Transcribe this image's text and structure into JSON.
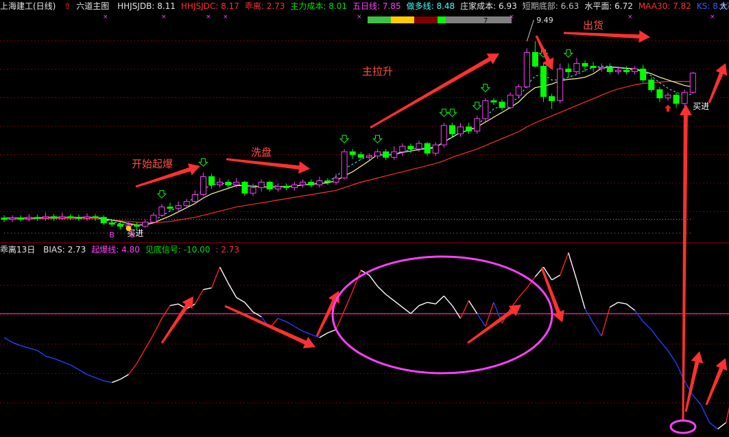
{
  "header": {
    "stock_name": "上海建工(日线)",
    "indicator_name": "六道主图",
    "items": [
      {
        "label": "HHJSJDB:",
        "value": "8.11",
        "color": "#e6e6e6"
      },
      {
        "label": "HHJSJDC:",
        "value": "8.17",
        "color": "#ff3030"
      },
      {
        "label": "乖离:",
        "value": "2.73",
        "color": "#ff3030"
      },
      {
        "label": "主力成本:",
        "value": "8.01",
        "color": "#00e000"
      },
      {
        "label": "五日线:",
        "value": "7.85",
        "color": "#ff40ff"
      },
      {
        "label": "做多线:",
        "value": "8.48",
        "color": "#40ffff"
      },
      {
        "label": "庄家成本:",
        "value": "6.93",
        "color": "#e6e6e6"
      },
      {
        "label": "短期底部:",
        "value": "6.63",
        "color": "#bbbbbb"
      },
      {
        "label": "水平面:",
        "value": "6.72",
        "color": "#e6e6e6"
      },
      {
        "label": "MAA30:",
        "value": "7.82",
        "color": "#ff3030"
      },
      {
        "label": "KS:",
        "value": "8.07",
        "color": "#3060ff"
      }
    ],
    "corner": "大"
  },
  "panel2": {
    "name": "乖离13日",
    "items": [
      {
        "label": "BIAS:",
        "value": "2.73",
        "color": "#e6e6e6"
      },
      {
        "label": "起爆线:",
        "value": "4.80",
        "color": "#ff40ff"
      },
      {
        "label": "见底信号:",
        "value": "-10.00",
        "color": "#00e000"
      },
      {
        "label": ":",
        "value": "2.73",
        "color": "#ff3030"
      }
    ]
  },
  "strength_bar": {
    "segments": [
      {
        "color": "#40c040"
      },
      {
        "color": "#ffcc00"
      },
      {
        "color": "#800000"
      },
      {
        "color": "#00ff00"
      },
      {
        "color": "#808080"
      }
    ],
    "marker": "7"
  },
  "annotations": {
    "start": "开始起爆",
    "wash": "洗盘",
    "main_up": "主拉升",
    "sell": "出货",
    "buy1": "买进",
    "buy2": "买进",
    "b1": "B",
    "b2": "B",
    "peak": "9.49"
  },
  "chart_data": [
    {
      "type": "candlestick",
      "title": "上海建工(日线)",
      "peak_label": 9.49,
      "ylim": [
        6.3,
        9.6
      ],
      "candles": [
        [
          6.62,
          6.6,
          6.66,
          6.56
        ],
        [
          6.6,
          6.62,
          6.66,
          6.56
        ],
        [
          6.62,
          6.61,
          6.66,
          6.57
        ],
        [
          6.61,
          6.63,
          6.68,
          6.57
        ],
        [
          6.63,
          6.62,
          6.67,
          6.58
        ],
        [
          6.62,
          6.64,
          6.7,
          6.58
        ],
        [
          6.64,
          6.62,
          6.68,
          6.58
        ],
        [
          6.62,
          6.64,
          6.7,
          6.59
        ],
        [
          6.64,
          6.63,
          6.68,
          6.59
        ],
        [
          6.63,
          6.62,
          6.67,
          6.58
        ],
        [
          6.62,
          6.64,
          6.69,
          6.58
        ],
        [
          6.64,
          6.63,
          6.68,
          6.58
        ],
        [
          6.63,
          6.55,
          6.66,
          6.52
        ],
        [
          6.55,
          6.53,
          6.6,
          6.5
        ],
        [
          6.53,
          6.5,
          6.56,
          6.45
        ],
        [
          6.5,
          6.52,
          6.56,
          6.46
        ],
        [
          6.52,
          6.5,
          6.56,
          6.46
        ],
        [
          6.5,
          6.56,
          6.6,
          6.48
        ],
        [
          6.56,
          6.66,
          6.7,
          6.54
        ],
        [
          6.66,
          6.78,
          6.82,
          6.64
        ],
        [
          6.78,
          6.76,
          6.84,
          6.72
        ],
        [
          6.76,
          6.8,
          6.86,
          6.72
        ],
        [
          6.8,
          6.86,
          6.9,
          6.76
        ],
        [
          6.86,
          6.96,
          7.02,
          6.82
        ],
        [
          6.96,
          7.22,
          7.28,
          6.94
        ],
        [
          7.22,
          7.1,
          7.26,
          7.04
        ],
        [
          7.1,
          7.14,
          7.2,
          7.06
        ],
        [
          7.14,
          7.1,
          7.18,
          7.04
        ],
        [
          7.1,
          7.14,
          7.2,
          7.06
        ],
        [
          7.14,
          6.98,
          7.16,
          6.94
        ],
        [
          6.98,
          7.06,
          7.12,
          6.94
        ],
        [
          7.06,
          7.14,
          7.18,
          7.0
        ],
        [
          7.14,
          7.04,
          7.16,
          7.0
        ],
        [
          7.04,
          7.08,
          7.12,
          7.0
        ],
        [
          7.08,
          7.06,
          7.12,
          7.02
        ],
        [
          7.06,
          7.1,
          7.14,
          7.02
        ],
        [
          7.1,
          7.14,
          7.18,
          7.06
        ],
        [
          7.14,
          7.1,
          7.18,
          7.06
        ],
        [
          7.1,
          7.16,
          7.22,
          7.06
        ],
        [
          7.16,
          7.14,
          7.2,
          7.1
        ],
        [
          7.14,
          7.2,
          7.26,
          7.1
        ],
        [
          7.2,
          7.58,
          7.62,
          7.18
        ],
        [
          7.58,
          7.54,
          7.62,
          7.48
        ],
        [
          7.54,
          7.5,
          7.58,
          7.46
        ],
        [
          7.5,
          7.52,
          7.56,
          7.46
        ],
        [
          7.52,
          7.58,
          7.62,
          7.48
        ],
        [
          7.58,
          7.5,
          7.62,
          7.46
        ],
        [
          7.5,
          7.58,
          7.66,
          7.46
        ],
        [
          7.58,
          7.66,
          7.7,
          7.52
        ],
        [
          7.66,
          7.62,
          7.7,
          7.56
        ],
        [
          7.62,
          7.7,
          7.74,
          7.58
        ],
        [
          7.7,
          7.56,
          7.72,
          7.52
        ],
        [
          7.56,
          7.68,
          7.72,
          7.52
        ],
        [
          7.68,
          7.96,
          8.0,
          7.64
        ],
        [
          7.96,
          7.84,
          8.0,
          7.78
        ],
        [
          7.84,
          7.94,
          8.0,
          7.8
        ],
        [
          7.94,
          7.88,
          8.0,
          7.84
        ],
        [
          7.88,
          8.06,
          8.1,
          7.84
        ],
        [
          8.06,
          8.32,
          8.36,
          8.02
        ],
        [
          8.32,
          8.3,
          8.36,
          8.26
        ],
        [
          8.3,
          8.22,
          8.34,
          8.18
        ],
        [
          8.22,
          8.4,
          8.44,
          8.2
        ],
        [
          8.4,
          8.52,
          8.56,
          8.36
        ],
        [
          8.52,
          9.02,
          9.08,
          8.5
        ],
        [
          9.02,
          8.82,
          9.18,
          8.8
        ],
        [
          8.82,
          8.38,
          8.86,
          8.3
        ],
        [
          8.38,
          8.32,
          8.42,
          8.2
        ],
        [
          8.32,
          8.78,
          8.86,
          8.28
        ],
        [
          8.78,
          8.74,
          8.86,
          8.66
        ],
        [
          8.74,
          8.86,
          8.94,
          8.7
        ],
        [
          8.86,
          8.82,
          8.9,
          8.74
        ],
        [
          8.82,
          8.8,
          8.88,
          8.74
        ],
        [
          8.8,
          8.8,
          8.86,
          8.74
        ],
        [
          8.8,
          8.74,
          8.86,
          8.7
        ],
        [
          8.74,
          8.76,
          8.82,
          8.7
        ],
        [
          8.76,
          8.74,
          8.82,
          8.7
        ],
        [
          8.74,
          8.78,
          8.82,
          8.7
        ],
        [
          8.78,
          8.62,
          8.84,
          8.58
        ],
        [
          8.62,
          8.48,
          8.66,
          8.44
        ],
        [
          8.48,
          8.36,
          8.52,
          8.3
        ],
        [
          8.36,
          8.4,
          8.44,
          8.32
        ],
        [
          8.4,
          8.28,
          8.44,
          8.22
        ],
        [
          8.28,
          8.44,
          8.48,
          8.24
        ],
        [
          8.44,
          8.72,
          8.74,
          8.42
        ]
      ],
      "ma_fast": [
        6.62,
        6.62,
        6.62,
        6.62,
        6.62,
        6.63,
        6.63,
        6.63,
        6.63,
        6.63,
        6.63,
        6.63,
        6.61,
        6.59,
        6.57,
        6.54,
        6.52,
        6.52,
        6.55,
        6.6,
        6.65,
        6.71,
        6.77,
        6.83,
        6.91,
        6.97,
        7.01,
        7.05,
        7.09,
        7.09,
        7.08,
        7.07,
        7.07,
        7.07,
        7.08,
        7.08,
        7.1,
        7.11,
        7.12,
        7.13,
        7.16,
        7.23,
        7.29,
        7.37,
        7.45,
        7.54,
        7.53,
        7.54,
        7.57,
        7.59,
        7.61,
        7.63,
        7.65,
        7.72,
        7.79,
        7.86,
        7.89,
        7.94,
        8.01,
        8.08,
        8.15,
        8.22,
        8.3,
        8.42,
        8.51,
        8.53,
        8.56,
        8.61,
        8.63,
        8.64,
        8.66,
        8.71,
        8.79,
        8.81,
        8.8,
        8.79,
        8.78,
        8.75,
        8.71,
        8.66,
        8.62,
        8.58,
        8.54,
        8.52
      ],
      "ma_slow": [
        6.6,
        6.6,
        6.6,
        6.6,
        6.61,
        6.61,
        6.61,
        6.61,
        6.61,
        6.61,
        6.61,
        6.61,
        6.6,
        6.59,
        6.58,
        6.57,
        6.56,
        6.55,
        6.55,
        6.56,
        6.57,
        6.59,
        6.61,
        6.63,
        6.66,
        6.69,
        6.72,
        6.75,
        6.78,
        6.8,
        6.82,
        6.84,
        6.86,
        6.88,
        6.9,
        6.92,
        6.94,
        6.96,
        6.98,
        7.0,
        7.02,
        7.06,
        7.1,
        7.14,
        7.17,
        7.2,
        7.23,
        7.26,
        7.29,
        7.32,
        7.35,
        7.38,
        7.41,
        7.45,
        7.5,
        7.54,
        7.58,
        7.62,
        7.67,
        7.72,
        7.77,
        7.82,
        7.87,
        7.94,
        8.0,
        8.05,
        8.1,
        8.15,
        8.2,
        8.25,
        8.3,
        8.35,
        8.4,
        8.45,
        8.49,
        8.52,
        8.55,
        8.57,
        8.58,
        8.59,
        8.6,
        8.6,
        8.6,
        8.6
      ],
      "ma_dash": [
        6.62,
        6.62,
        6.62,
        6.62,
        6.62,
        6.63,
        6.63,
        6.63,
        6.63,
        6.63,
        6.63,
        6.63,
        6.6,
        6.57,
        6.54,
        6.52,
        6.51,
        6.53,
        6.58,
        6.65,
        6.72,
        6.78,
        6.84,
        6.92,
        7.04,
        7.1,
        7.12,
        7.12,
        7.12,
        7.08,
        7.08,
        7.1,
        7.1,
        7.08,
        7.08,
        7.08,
        7.1,
        7.12,
        7.13,
        7.15,
        7.22,
        7.33,
        7.4,
        7.47,
        7.52,
        7.54,
        7.53,
        7.55,
        7.58,
        7.61,
        7.64,
        7.62,
        7.64,
        7.72,
        7.8,
        7.86,
        7.9,
        7.96,
        8.08,
        8.2,
        8.25,
        8.3,
        8.36,
        8.54,
        8.68,
        8.7,
        8.62,
        8.62,
        8.66,
        8.7,
        8.76,
        8.8,
        8.82,
        8.82,
        8.8,
        8.78,
        8.77,
        8.74,
        8.68,
        8.58,
        8.5,
        8.44,
        8.4,
        8.42
      ],
      "support_line": [
        6.4,
        6.4,
        6.4,
        6.4,
        6.4,
        6.4,
        6.4,
        6.4,
        6.4,
        6.4,
        6.4,
        6.4,
        6.4,
        6.4,
        6.4,
        6.4,
        6.4,
        6.4,
        6.4,
        6.4,
        6.4,
        6.4,
        6.4,
        6.4,
        6.4,
        6.4,
        6.4,
        6.4,
        6.4,
        6.4,
        6.4,
        6.4,
        6.4,
        6.4,
        6.4,
        6.4,
        6.4,
        6.4,
        6.4,
        6.4,
        6.4,
        6.4,
        6.4,
        6.4,
        6.4,
        6.4,
        6.4,
        6.4,
        6.4,
        6.4,
        6.4,
        6.4,
        6.4,
        6.4,
        6.4,
        6.4,
        6.4,
        6.4,
        6.4,
        6.4,
        6.4,
        6.4,
        6.4,
        6.4,
        6.4,
        6.4,
        6.4,
        6.4,
        6.4,
        6.4,
        6.4,
        6.4,
        6.4,
        6.4,
        6.4,
        6.4,
        6.4,
        6.4,
        6.4,
        6.4,
        6.4,
        6.4,
        6.4,
        6.4
      ],
      "lower_band": [
        6.6,
        6.6,
        6.6,
        6.6,
        6.6,
        6.6,
        6.6,
        6.6,
        6.6,
        6.6,
        6.6,
        6.6,
        6.6,
        6.6,
        6.6,
        6.6,
        6.6,
        6.6,
        6.6,
        6.6,
        6.6,
        6.6,
        6.6,
        6.6,
        6.6,
        6.6,
        6.6,
        6.6,
        6.6,
        6.6,
        6.6,
        6.6,
        6.6,
        6.6,
        6.6,
        6.6,
        6.6,
        6.6,
        6.6,
        6.6,
        6.6,
        6.6,
        6.6,
        6.6,
        6.6,
        6.6,
        6.6,
        6.6,
        6.6,
        6.6,
        6.6,
        6.6,
        6.6,
        6.6,
        6.6,
        6.6,
        6.6,
        6.6,
        6.6,
        6.6,
        6.6,
        6.6,
        6.6,
        6.6,
        6.6,
        6.6,
        6.6,
        6.6,
        6.6,
        6.6,
        6.6,
        6.6,
        6.6,
        6.6,
        6.6,
        6.6,
        6.6,
        6.6,
        6.6,
        6.6,
        6.6,
        6.6,
        6.6,
        6.6
      ],
      "down_arrows_at": [
        19,
        24,
        41,
        45,
        53,
        54,
        57,
        58,
        65,
        68
      ],
      "up_arrow_at": [
        80
      ],
      "buy_marks_at": [
        14,
        82
      ]
    },
    {
      "type": "line",
      "title": "乖离13日",
      "ylim": [
        -10,
        12
      ],
      "threshold": 4.8,
      "bottom_signal": -10.0,
      "values": [
        1.8,
        1.2,
        0.8,
        0.5,
        0.2,
        -0.5,
        -0.8,
        -1.2,
        -1.6,
        -2.2,
        -2.8,
        -3.2,
        -3.6,
        -3.8,
        -3.4,
        -2.8,
        -1.4,
        0.4,
        2.2,
        4.2,
        5.8,
        6.0,
        5.4,
        6.0,
        7.8,
        8.0,
        10.6,
        8.6,
        6.8,
        6.2,
        5.0,
        4.4,
        3.0,
        4.2,
        3.8,
        3.2,
        2.6,
        2.2,
        1.8,
        2.4,
        2.8,
        5.2,
        7.6,
        10.2,
        9.6,
        8.2,
        7.2,
        6.4,
        5.6,
        4.8,
        5.8,
        6.2,
        6.0,
        7.0,
        5.8,
        4.2,
        6.4,
        4.8,
        3.2,
        6.2,
        3.6,
        5.4,
        6.8,
        8.0,
        9.4,
        10.6,
        9.0,
        9.6,
        12.4,
        9.0,
        5.4,
        3.6,
        2.0,
        5.6,
        6.2,
        6.0,
        5.2,
        3.8,
        2.8,
        1.4,
        0.2,
        -1.4,
        -3.6,
        -5.4,
        -6.6,
        -8.8,
        -9.6,
        -8.8,
        -4.0
      ],
      "segment_colors": "white/blue/red by trend"
    }
  ]
}
